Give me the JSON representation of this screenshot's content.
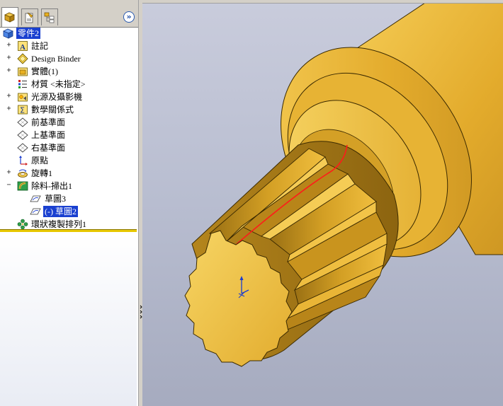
{
  "panel": {
    "tabs": [
      {
        "name": "featuremanager",
        "icon": "feature-tree-icon",
        "active": true
      },
      {
        "name": "propertymanager",
        "icon": "property-manager-icon",
        "active": false
      },
      {
        "name": "configurationmanager",
        "icon": "configuration-manager-icon",
        "active": false
      }
    ],
    "expand_symbol": "»"
  },
  "tree": {
    "root": {
      "label": "零件2",
      "icon": "part-icon"
    },
    "items": [
      {
        "label": "註記",
        "icon": "annotations-icon",
        "expander": "+"
      },
      {
        "label": "Design Binder",
        "icon": "design-binder-icon",
        "expander": "+"
      },
      {
        "label": "實體(1)",
        "icon": "solid-bodies-icon",
        "expander": "+"
      },
      {
        "label": "材質 <未指定>",
        "icon": "material-icon",
        "expander": ""
      },
      {
        "label": "光源及攝影機",
        "icon": "lights-cameras-icon",
        "expander": "+"
      },
      {
        "label": "數學關係式",
        "icon": "equations-icon",
        "expander": "+"
      },
      {
        "label": "前基準面",
        "icon": "plane-icon",
        "expander": ""
      },
      {
        "label": "上基準面",
        "icon": "plane-icon",
        "expander": ""
      },
      {
        "label": "右基準面",
        "icon": "plane-icon",
        "expander": ""
      },
      {
        "label": "原點",
        "icon": "origin-icon",
        "expander": ""
      },
      {
        "label": "旋轉1",
        "icon": "revolve-icon",
        "expander": "+"
      },
      {
        "label": "除料-掃出1",
        "icon": "swept-cut-icon",
        "expander": "−"
      },
      {
        "label": "草圖3",
        "icon": "sketch-icon",
        "expander": "",
        "child": true
      },
      {
        "label": "(-) 草圖2",
        "icon": "sketch-icon",
        "expander": "",
        "child": true,
        "selected": true
      },
      {
        "label": "環狀複製排列1",
        "icon": "circular-pattern-icon",
        "expander": ""
      }
    ]
  },
  "colors": {
    "part_body": "#e9b533",
    "part_shadow": "#b98a1c",
    "selection": "#1a40d0",
    "rollback_bar": "#e8c800",
    "sweep_path": "#ff1a1a",
    "viewport_top": "#c9ccdc",
    "viewport_bottom": "#a6abbf"
  }
}
